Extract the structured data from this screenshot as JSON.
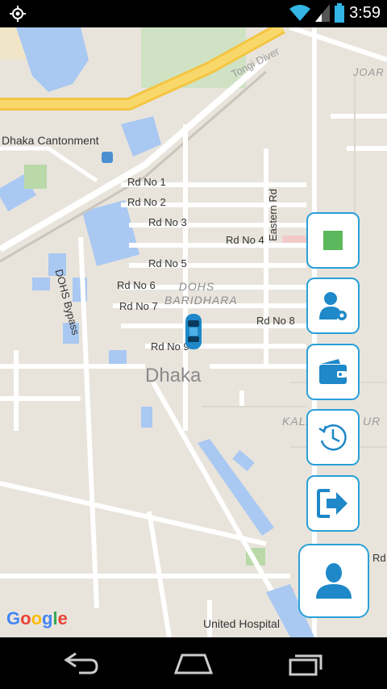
{
  "status_bar": {
    "time": "3:59",
    "icons": [
      "location-icon",
      "wifi-icon",
      "signal-icon",
      "battery-icon"
    ]
  },
  "map": {
    "labels": {
      "tongi": "Tongi Diver",
      "joar": "JOAR S",
      "cantonment": "Dhaka Cantonment",
      "rd1": "Rd No 1",
      "rd2": "Rd No 2",
      "rd3": "Rd No 3",
      "rd4": "Rd No 4",
      "rd5": "Rd No 5",
      "rd6": "Rd No 6",
      "rd7": "Rd No 7",
      "rd8": "Rd No 8",
      "rd9": "Rd No 9",
      "eastern": "Eastern Rd",
      "dohs_bypass": "DOHS Bypass",
      "dohs_baridhara_1": "DOHS",
      "dohs_baridhara_2": "BARIDHARA",
      "dhaka": "Dhaka",
      "kala": "KALA",
      "ur": "UR",
      "rd_right": "Rd",
      "hospital": "United Hospital"
    },
    "google_logo": [
      "G",
      "o",
      "o",
      "g",
      "l",
      "e"
    ],
    "google_colors": [
      "#4285f4",
      "#ea4335",
      "#fbbc05",
      "#4285f4",
      "#34a853",
      "#ea4335"
    ]
  },
  "side_buttons": [
    {
      "name": "stop-button",
      "icon": "green-square-icon",
      "color": "#5cb85c"
    },
    {
      "name": "profile-settings-button",
      "icon": "user-gear-icon",
      "color": "#1e88c8"
    },
    {
      "name": "wallet-button",
      "icon": "wallet-icon",
      "color": "#1e88c8"
    },
    {
      "name": "history-button",
      "icon": "history-icon",
      "color": "#1e88c8"
    },
    {
      "name": "logout-button",
      "icon": "logout-icon",
      "color": "#1e88c8"
    },
    {
      "name": "profile-button",
      "icon": "user-icon",
      "color": "#1e88c8"
    }
  ],
  "nav_bar": {
    "icons": [
      "back-icon",
      "home-icon",
      "recents-icon"
    ]
  }
}
